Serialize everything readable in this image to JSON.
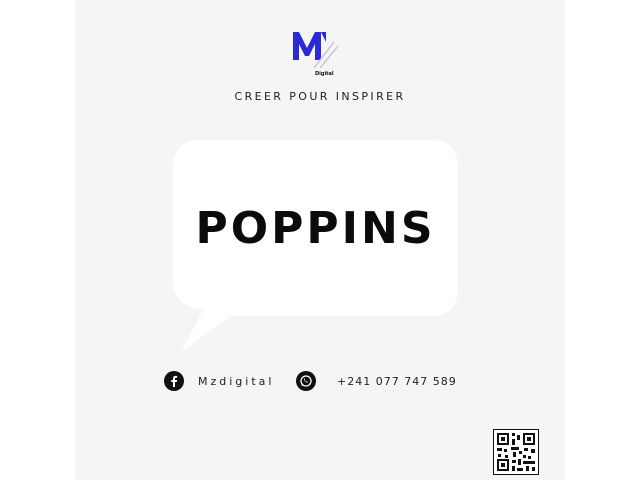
{
  "brand": {
    "logo_icon": "m-digital-logo",
    "logo_caption": "Digital",
    "tagline": "CREER POUR INSPIRER",
    "colors": {
      "logo_blue": "#2b2bd6",
      "background": "#f5f5f5",
      "text": "#0b0b0b"
    }
  },
  "bubble": {
    "text": "POPPINS"
  },
  "contacts": {
    "facebook": {
      "icon": "facebook-icon",
      "handle": "Mzdigital"
    },
    "whatsapp": {
      "icon": "whatsapp-icon",
      "phone": "+241 077 747 589"
    }
  },
  "qr_code": {
    "icon": "qr-code-icon"
  }
}
